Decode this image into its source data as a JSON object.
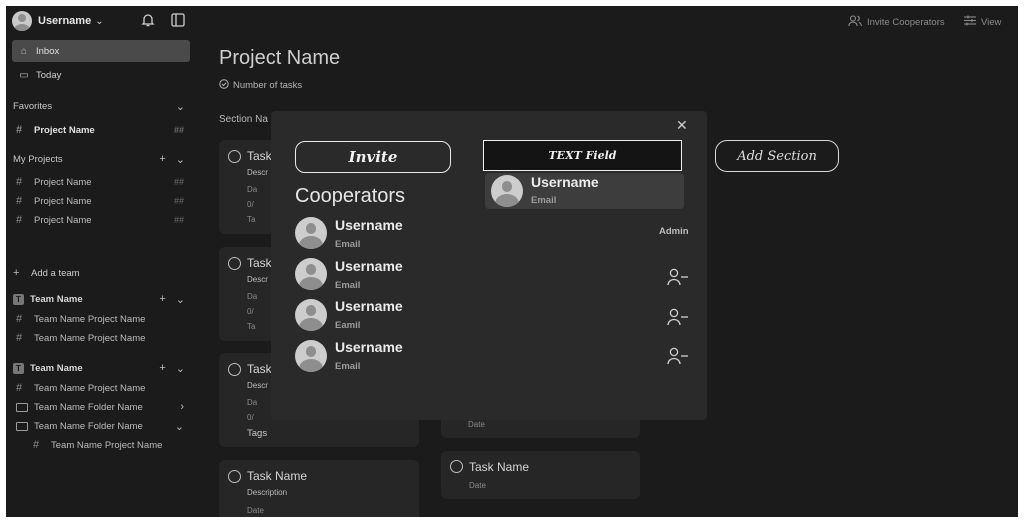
{
  "sidebar": {
    "username": "Username",
    "nav": [
      {
        "label": "Inbox",
        "icon": "inbox-icon"
      },
      {
        "label": "Today",
        "icon": "calendar-icon"
      }
    ],
    "favorites": {
      "title": "Favorites",
      "items": [
        {
          "label": "Project Name",
          "count": "##"
        }
      ]
    },
    "my_projects": {
      "title": "My Projects",
      "items": [
        {
          "label": "Project Name",
          "count": "##"
        },
        {
          "label": "Project Name",
          "count": "##"
        },
        {
          "label": "Project Name",
          "count": "##"
        }
      ]
    },
    "add_team": "Add a team",
    "teams": [
      {
        "badge": "T",
        "name": "Team Name",
        "items": [
          {
            "label": "Team Name Project Name"
          },
          {
            "label": "Team Name Project Name"
          }
        ]
      },
      {
        "badge": "T",
        "name": "Team Name",
        "items": [
          {
            "label": "Team Name Project Name"
          },
          {
            "label": "Team Name Folder Name"
          },
          {
            "label": "Team Name Folder Name"
          },
          {
            "label": "Team Name Project Name"
          }
        ]
      }
    ]
  },
  "header": {
    "invite_label": "Invite Cooperators",
    "view_label": "View"
  },
  "main": {
    "project_title": "Project Name",
    "num_tasks": "Number of  tasks",
    "section_name": "Section Na",
    "cards": [
      {
        "name": "Task",
        "desc": "Descr",
        "date": "Da",
        "sub": "0/",
        "tags": "Ta"
      },
      {
        "name": "Task",
        "desc": "Descr",
        "date": "Da",
        "sub": "0/",
        "tags": "Ta"
      },
      {
        "name": "Task",
        "desc": "Descr",
        "date": "Da",
        "sub": "0/",
        "tags": "Tags"
      },
      {
        "name": "Task Name",
        "desc": "Description",
        "date": "Date"
      }
    ],
    "col2_cards": [
      {
        "date": "Date"
      },
      {
        "name": "Task Name",
        "date": "Date"
      }
    ],
    "add_section": "Add Section"
  },
  "modal": {
    "invite_button": "Invite",
    "title": "Cooperators",
    "text_field": "TEXT Field",
    "suggestion": {
      "username": "Username",
      "email": "Email"
    },
    "admin_label": "Admin",
    "members": [
      {
        "username": "Username",
        "email": "Email"
      },
      {
        "username": "Username",
        "email": "Email"
      },
      {
        "username": "Username",
        "email": "Eamil"
      },
      {
        "username": "Username",
        "email": "Email"
      }
    ]
  }
}
